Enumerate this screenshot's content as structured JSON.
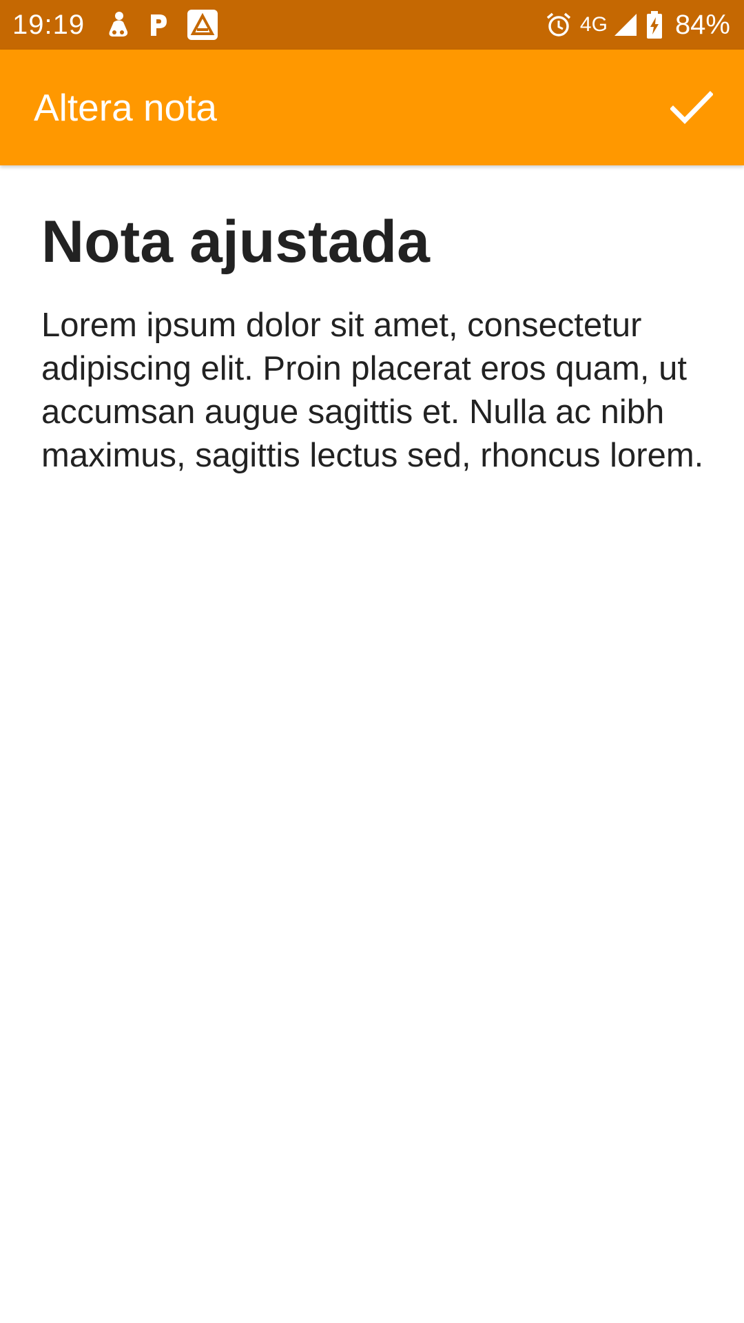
{
  "status_bar": {
    "time": "19:19",
    "network": "4G",
    "battery": "84%",
    "icons": [
      "notification-app-icon",
      "parking-icon",
      "app-a-icon",
      "alarm-icon",
      "signal-icon",
      "battery-charging-icon"
    ],
    "background_color": "#c56802"
  },
  "app_bar": {
    "title": "Altera nota",
    "action_icon": "check-icon",
    "background_color": "#ff9800"
  },
  "note": {
    "title": "Nota ajustada",
    "body": "Lorem ipsum dolor sit amet, consectetur adipiscing elit. Proin placerat eros quam, ut accumsan augue sagittis et. Nulla ac nibh maximus, sagittis lectus sed, rhoncus lorem."
  }
}
